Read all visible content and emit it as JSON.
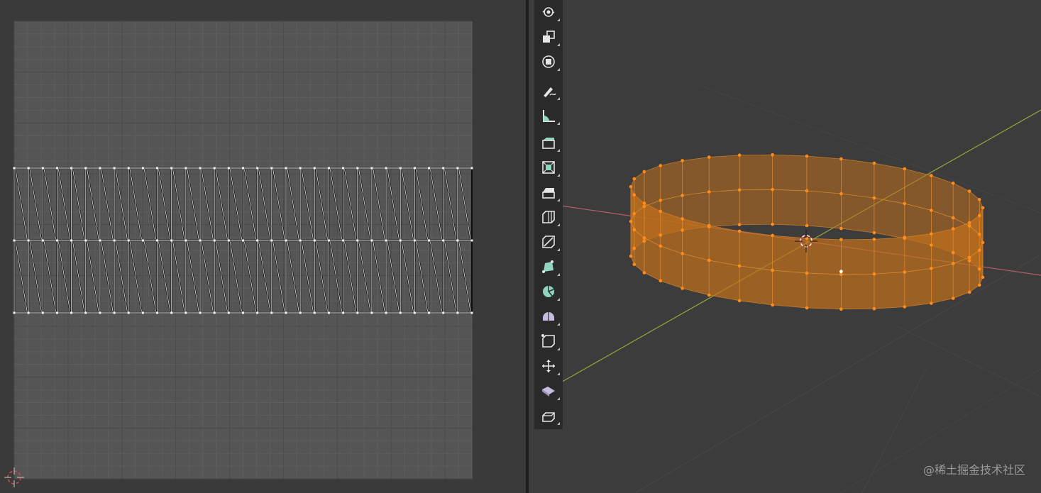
{
  "uv_editor": {
    "grid_columns": 34,
    "grid_rows": 36,
    "uv_strips": 2,
    "uv_segments": 32
  },
  "viewport": {
    "mesh": "ring-band",
    "mesh_color": "#c0701c",
    "vertex_color": "#ff8c1a",
    "x_axis_color": "#b85a6a",
    "y_axis_color": "#8faa3a",
    "ring_segments": 32
  },
  "toolbar": {
    "tools": [
      {
        "name": "rotate-tool-icon"
      },
      {
        "name": "scale-tool-icon"
      },
      {
        "name": "transform-tool-icon"
      },
      {
        "name": "annotate-tool-icon"
      },
      {
        "name": "measure-tool-icon"
      },
      {
        "name": "extrude-region-tool-icon"
      },
      {
        "name": "inset-faces-tool-icon"
      },
      {
        "name": "bevel-tool-icon"
      },
      {
        "name": "loop-cut-tool-icon"
      },
      {
        "name": "knife-tool-icon"
      },
      {
        "name": "poly-build-tool-icon"
      },
      {
        "name": "spin-tool-icon"
      },
      {
        "name": "smooth-tool-icon"
      },
      {
        "name": "edge-slide-tool-icon"
      },
      {
        "name": "shrink-fatten-tool-icon"
      },
      {
        "name": "shear-tool-icon"
      },
      {
        "name": "rip-region-tool-icon"
      }
    ]
  },
  "watermark": "@稀土掘金技术社区"
}
